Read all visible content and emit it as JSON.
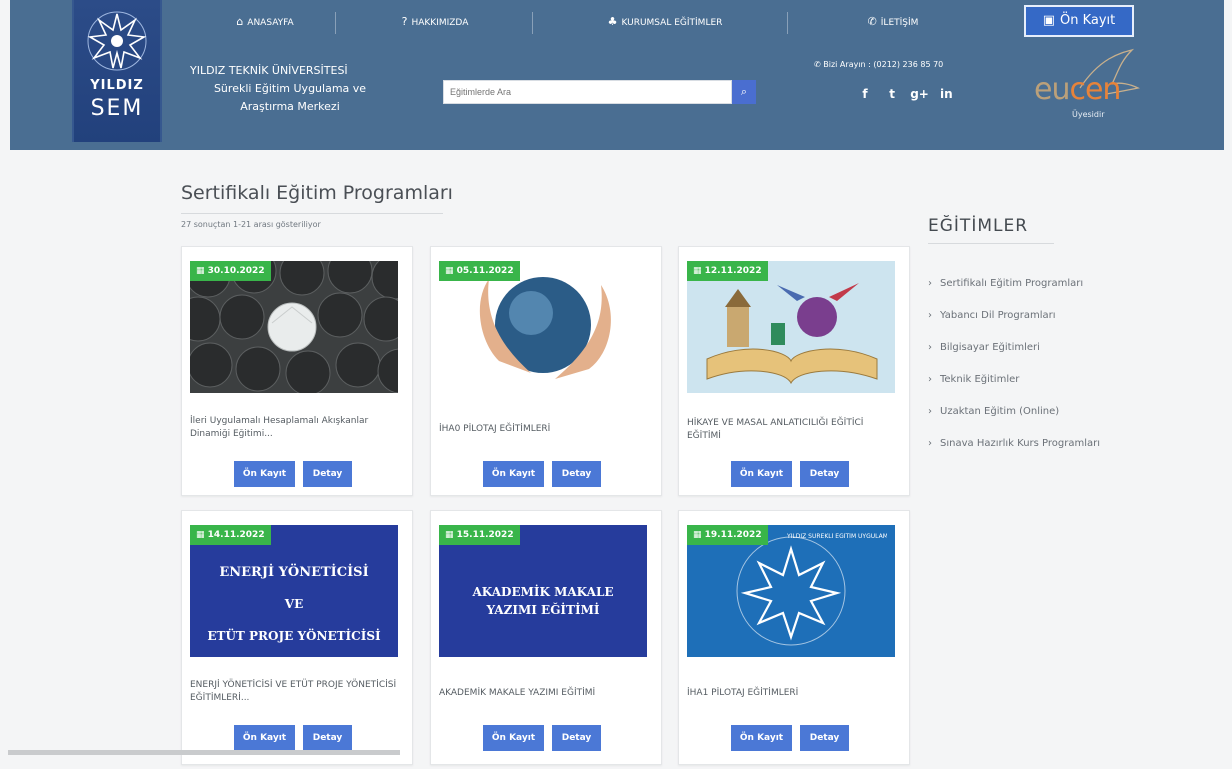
{
  "brand": {
    "logo_top": "YILDIZ",
    "logo_bottom": "SEM",
    "university_line1": "YILDIZ TEKNİK ÜNİVERSİTESİ",
    "university_line2": "Sürekli Eğitim Uygulama ve",
    "university_line3": "Araştırma Merkezi"
  },
  "nav": {
    "home": "ANASAYFA",
    "about": "HAKKIMIZDA",
    "corporate": "KURUMSAL EĞİTİMLER",
    "contact": "İLETİŞİM",
    "preregister": "Ön Kayıt"
  },
  "search": {
    "placeholder": "Eğitimlerde Ara"
  },
  "contact": {
    "phone": "Bizi Arayın : (0212) 236 85 70"
  },
  "social": [
    "f",
    "t",
    "g+",
    "in"
  ],
  "eucen": {
    "word_a": "eu",
    "word_b": "cen",
    "member": "Üyesidir"
  },
  "main": {
    "title": "Sertifikalı Eğitim Programları",
    "results": "27 sonuçtan 1-21 arası gösteriliyor"
  },
  "cards": [
    {
      "date": "30.10.2022",
      "title": "İleri Uygulamalı Hesaplamalı Akışkanlar Dinamiği Eğitimi...",
      "btn_register": "Ön Kayıt",
      "btn_detail": "Detay"
    },
    {
      "date": "05.11.2022",
      "title": "İHA0 PİLOTAJ EĞİTİMLERİ",
      "btn_register": "Ön Kayıt",
      "btn_detail": "Detay"
    },
    {
      "date": "12.11.2022",
      "title": "HİKAYE VE MASAL ANLATICILIĞI EĞİTİCİ EĞİTİMİ",
      "btn_register": "Ön Kayıt",
      "btn_detail": "Detay"
    },
    {
      "date": "14.11.2022",
      "title": "ENERJİ YÖNETİCİSİ VE ETÜT PROJE YÖNETİCİSİ EĞİTİMLERİ...",
      "btn_register": "Ön Kayıt",
      "btn_detail": "Detay",
      "image_text1": "ENERJİ YÖNETİCİSİ",
      "image_text2": "VE",
      "image_text3": "ETÜT PROJE YÖNETİCİSİ"
    },
    {
      "date": "15.11.2022",
      "title": "AKADEMİK MAKALE YAZIMI EĞİTİMİ",
      "btn_register": "Ön Kayıt",
      "btn_detail": "Detay",
      "image_text1": "AKADEMİK MAKALE",
      "image_text2": "YAZIMI EĞİTİMİ"
    },
    {
      "date": "19.11.2022",
      "title": "İHA1 PİLOTAJ EĞİTİMLERİ",
      "btn_register": "Ön Kayıt",
      "btn_detail": "Detay",
      "image_text1": "YILDIZ SÜREKLİ EĞİTİM UYGULAMA VE ARAŞTIRMA MERKEZİ"
    }
  ],
  "sidebar": {
    "title": "EĞİTİMLER",
    "items": [
      "Sertifikalı Eğitim Programları",
      "Yabancı Dil Programları",
      "Bilgisayar Eğitimleri",
      "Teknik Eğitimler",
      "Uzaktan Eğitim (Online)",
      "Sınava Hazırlık Kurs Programları"
    ]
  },
  "colors": {
    "header": "#4a6e92",
    "button": "#4b78d6",
    "date_badge": "#39b54a",
    "accent_orange": "#e7833a"
  }
}
